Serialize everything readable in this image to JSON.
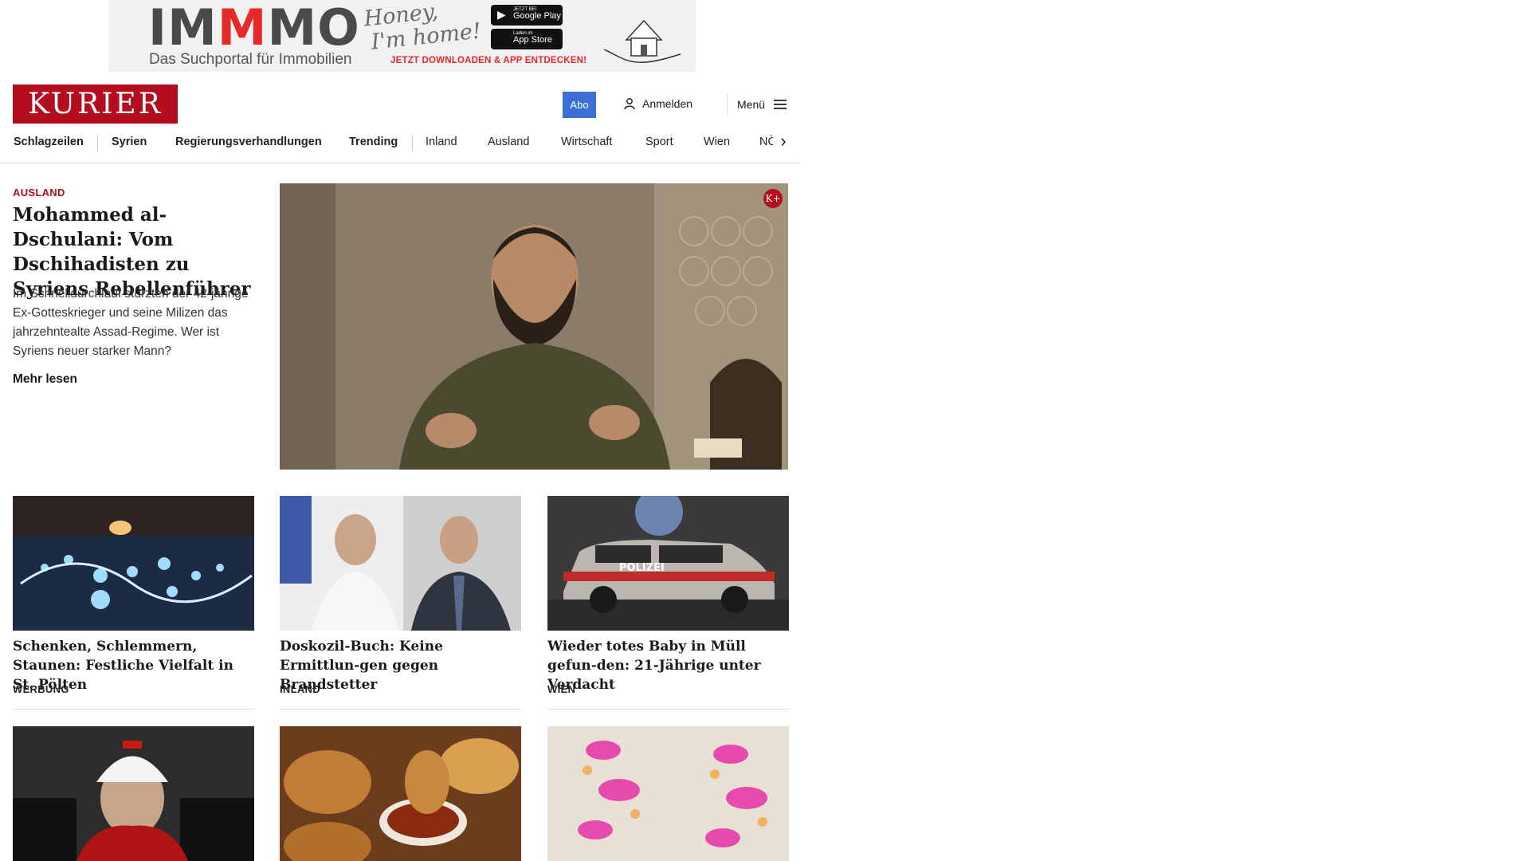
{
  "ad": {
    "logo_part1": "IM",
    "logo_m": "M",
    "logo_part2": "MO",
    "tagline": "Das Suchportal für Immobilien",
    "script_line1": "Honey,",
    "script_line2": "I'm home!",
    "google_small": "JETZT BEI",
    "google_label": "Google Play",
    "apple_small": "Laden im",
    "apple_label": "App Store",
    "cta": "JETZT DOWNLOADEN & APP ENTDECKEN!"
  },
  "header": {
    "logo": "KURIER",
    "abo": "Abo",
    "login": "Anmelden",
    "menu": "Menü"
  },
  "nav": {
    "items": [
      "Schlagzeilen",
      "Syrien",
      "Regierungsverhandlungen",
      "Trending",
      "Inland",
      "Ausland",
      "Wirtschaft",
      "Sport",
      "Wien",
      "NÖ"
    ]
  },
  "lead": {
    "kicker": "AUSLAND",
    "title": "Mohammed al-Dschulani: Vom Dschihadisten zu Syriens Rebellenführer",
    "teaser": "Im Schnelldurchlauf stürzten der 42-jährige Ex-Gotteskrieger und seine Milizen das jahrzehntealte Assad-Regime. Wer ist Syriens neuer starker Mann?",
    "more": "Mehr lesen",
    "badge": "K+"
  },
  "cards": [
    {
      "title": "Schenken, Schlemmern, Staunen: Festliche Vielfalt in St. Pölten",
      "category": "WERBUNG"
    },
    {
      "title": "Doskozil-Buch: Keine Ermittlun-gen gegen Brandstetter",
      "category": "INLAND"
    },
    {
      "title": "Wieder totes Baby in Müll gefun-den: 21-Jährige unter Verdacht",
      "category": "WIEN"
    }
  ],
  "images": {
    "police_label": "POLIZEI"
  },
  "colors": {
    "brand": "#b40d1f",
    "abo_button": "#3c6fd6"
  }
}
